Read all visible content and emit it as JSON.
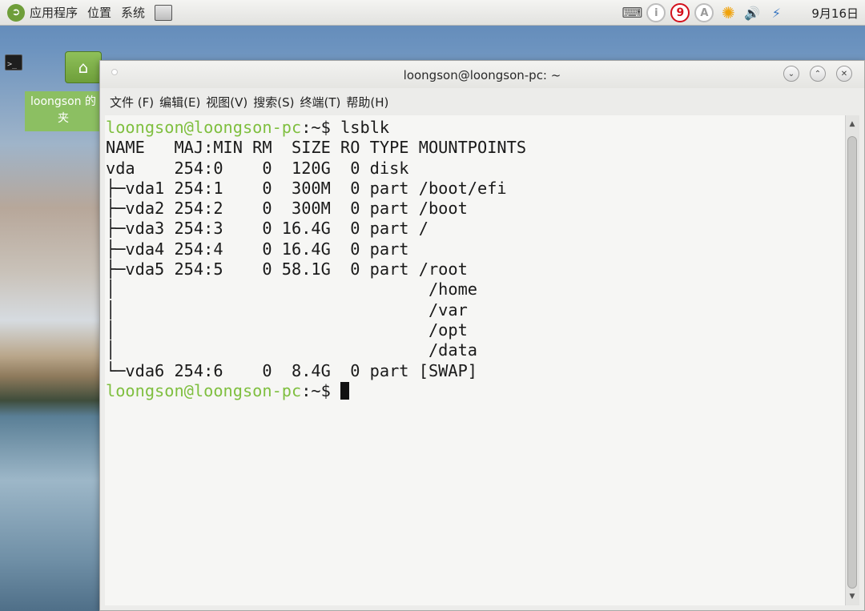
{
  "panel": {
    "logo_glyph": "➲",
    "menus": [
      "应用程序",
      "位置",
      "系统"
    ],
    "tray": {
      "info_label": "i",
      "updates_count": "9",
      "input_method_label": "A",
      "sun_glyph": "✺",
      "volume_glyph": "🔊",
      "network_glyph": "⚡",
      "clock": "9月16日"
    }
  },
  "desktop": {
    "home_icon_glyph": "⌂",
    "home_folder_label": "loongson 的\n夹"
  },
  "window": {
    "title": "loongson@loongson-pc: ~",
    "buttons": {
      "minimize": "⌄",
      "maximize": "⌃",
      "close": "✕"
    },
    "menubar": [
      "文件 (F)",
      "编辑(E)",
      "视图(V)",
      "搜索(S)",
      "终端(T)",
      "帮助(H)"
    ],
    "terminal": {
      "prompt": "loongson@loongson-pc",
      "prompt_suffix": ":~$ ",
      "command": "lsblk",
      "output": [
        "NAME   MAJ:MIN RM  SIZE RO TYPE MOUNTPOINTS",
        "vda    254:0    0  120G  0 disk",
        "├─vda1 254:1    0  300M  0 part /boot/efi",
        "├─vda2 254:2    0  300M  0 part /boot",
        "├─vda3 254:3    0 16.4G  0 part /",
        "├─vda4 254:4    0 16.4G  0 part",
        "├─vda5 254:5    0 58.1G  0 part /root",
        "│                                /home",
        "│                                /var",
        "│                                /opt",
        "│                                /data",
        "└─vda6 254:6    0  8.4G  0 part [SWAP]"
      ]
    }
  },
  "colors": {
    "prompt": "#7fbf3f",
    "badge": "#d3101b",
    "folder": "#8cbf62"
  }
}
